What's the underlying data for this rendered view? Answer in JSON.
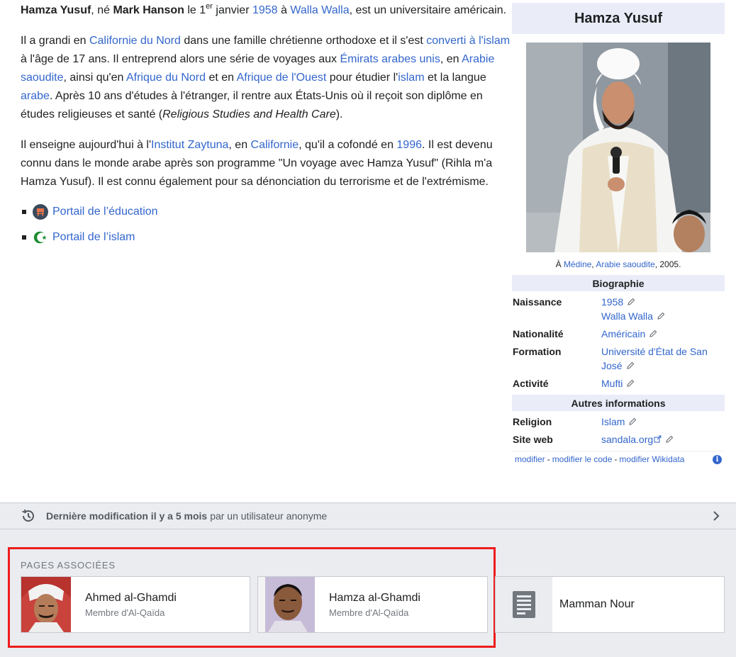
{
  "article": {
    "p1": {
      "name1": "Hamza Yusuf",
      "t1": ", né ",
      "name2": "Mark Hanson",
      "t2": " le 1",
      "sup": "er",
      "t3": " janvier ",
      "link_year": "1958",
      "t4": " à ",
      "link_city": "Walla Walla",
      "t5": ", est un universitaire américain."
    },
    "p2": {
      "t1": "Il a grandi en ",
      "l1": "Californie du Nord",
      "t2": " dans une famille chrétienne orthodoxe et il s'est ",
      "l2": "converti à l'islam",
      "t3": " à l'âge de 17 ans. Il entreprend alors une série de voyages aux ",
      "l3": "Émirats arabes unis",
      "t4": ", en ",
      "l4": "Arabie saoudite",
      "t5": ", ainsi qu'en ",
      "l5": "Afrique du Nord",
      "t6": " et en ",
      "l6": "Afrique de l'Ouest",
      "t7": " pour étudier l'",
      "l7": "islam",
      "t8": " et la langue ",
      "l8": "arabe",
      "t9": ". Après 10 ans d'études à l'étranger, il rentre aux États-Unis où il reçoit son diplôme en études religieuses et santé (",
      "i1": "Religious Studies and Health Care",
      "t10": ")."
    },
    "p3": {
      "t1": "Il enseigne aujourd'hui à l'",
      "l1": "Institut Zaytuna",
      "t2": ", en ",
      "l2": "Californie",
      "t3": ", qu'il a cofondé en ",
      "l3": "1996",
      "t4": ". Il est devenu connu dans le monde arabe après son programme \"Un voyage avec Hamza Yusuf\" (Rihla m'a Hamza Yusuf). Il est connu également pour sa dénonciation du terrorisme et de l'extrémisme."
    },
    "portals": [
      {
        "label": "Portail de l’éducation",
        "icon": "education-portal-icon"
      },
      {
        "label": "Portail de l’islam",
        "icon": "islam-crescent-icon"
      }
    ]
  },
  "infobox": {
    "title": "Hamza Yusuf",
    "caption": {
      "prefix": "À ",
      "l1": "Médine",
      "sep": ", ",
      "l2": "Arabie saoudite",
      "suffix": ", 2005."
    },
    "section_bio": "Biographie",
    "naissance": {
      "label": "Naissance",
      "v1": "1958",
      "v2": "Walla Walla"
    },
    "nationalite": {
      "label": "Nationalité",
      "v": "Américain"
    },
    "formation": {
      "label": "Formation",
      "v": "Université d'État de San José"
    },
    "activite": {
      "label": "Activité",
      "v": "Mufti"
    },
    "section_other": "Autres informations",
    "religion": {
      "label": "Religion",
      "v": "Islam"
    },
    "site": {
      "label": "Site web",
      "v": "sandala.org"
    },
    "footer": {
      "edit": "modifier",
      "edit_code": "modifier le code",
      "edit_wikidata": "modifier Wikidata",
      "dash": " - "
    }
  },
  "lastmod": {
    "bold": "Dernière modification il y a 5 mois",
    "rest": "par un utilisateur anonyme"
  },
  "related": {
    "heading": "PAGES ASSOCIÉES",
    "cards": [
      {
        "title": "Ahmed al-Ghamdi",
        "desc": "Membre d'Al-Qaïda"
      },
      {
        "title": "Hamza al-Ghamdi",
        "desc": "Membre d'Al-Qaïda"
      },
      {
        "title": "Mamman Nour",
        "desc": ""
      }
    ]
  },
  "colors": {
    "link": "#3366cc",
    "highlight": "#ee1c1c",
    "band": "#eaecf0",
    "infobox_header": "#eaecf8"
  }
}
